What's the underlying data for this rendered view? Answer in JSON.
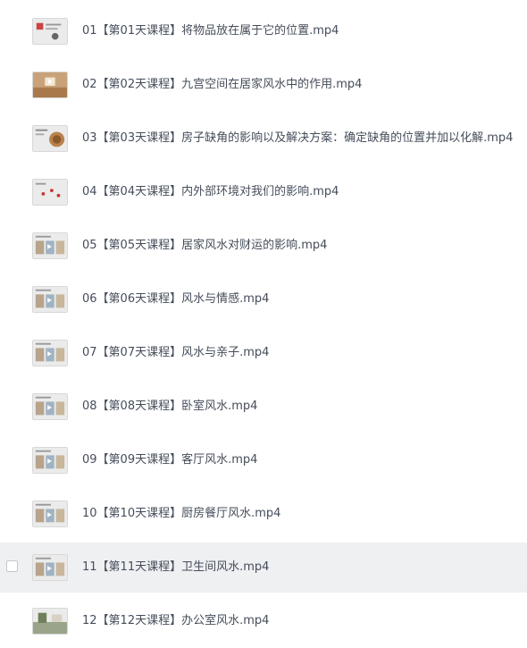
{
  "files": [
    {
      "name": "01【第01天课程】将物品放在属于它的位置.mp4",
      "thumb": "slide"
    },
    {
      "name": "02【第02天课程】九宫空间在居家风水中的作用.mp4",
      "thumb": "room-warm"
    },
    {
      "name": "03【第03天课程】房子缺角的影响以及解决方案：确定缺角的位置并加以化解.mp4",
      "thumb": "food"
    },
    {
      "name": "04【第04天课程】内外部环境对我们的影响.mp4",
      "thumb": "slide-dots"
    },
    {
      "name": "05【第05天课程】居家风水对财运的影响.mp4",
      "thumb": "slide-photos"
    },
    {
      "name": "06【第06天课程】风水与情感.mp4",
      "thumb": "slide-photos"
    },
    {
      "name": "07【第07天课程】风水与亲子.mp4",
      "thumb": "slide-photos"
    },
    {
      "name": "08【第08天课程】卧室风水.mp4",
      "thumb": "slide-photos"
    },
    {
      "name": "09【第09天课程】客厅风水.mp4",
      "thumb": "slide-photos"
    },
    {
      "name": "10【第10天课程】厨房餐厅风水.mp4",
      "thumb": "slide-photos"
    },
    {
      "name": "11【第11天课程】卫生间风水.mp4",
      "thumb": "slide-photos"
    },
    {
      "name": "12【第12天课程】办公室风水.mp4",
      "thumb": "slide-green"
    }
  ],
  "hovered_index": 10,
  "colors": {
    "hover_bg": "#eff0f2",
    "text": "#454d5a",
    "thumb_bg": "#e9e9e9"
  }
}
